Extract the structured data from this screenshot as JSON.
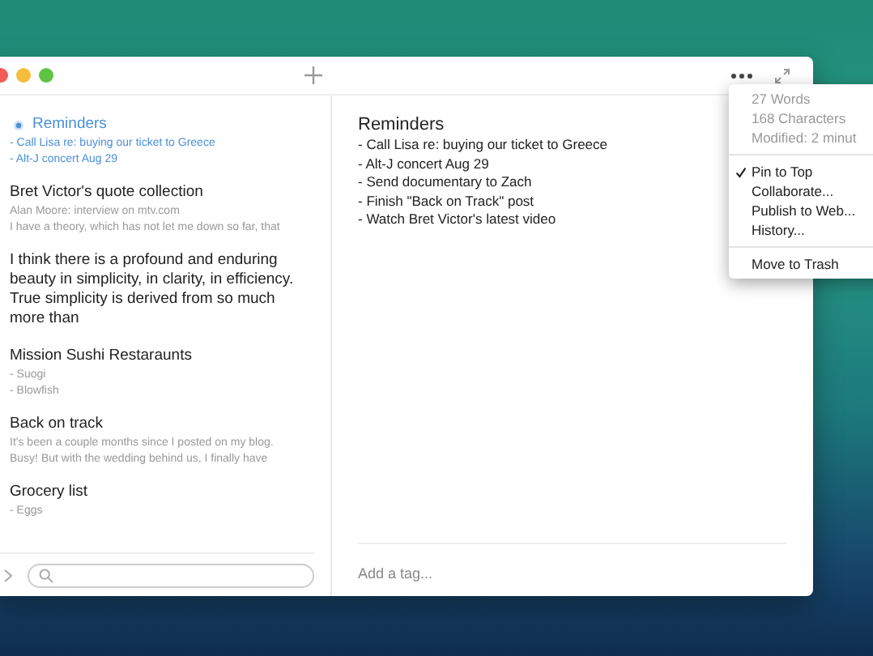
{
  "notes": [
    {
      "title": "Reminders",
      "lines": [
        "- Call Lisa re: buying our ticket to Greece",
        "- Alt-J concert Aug 29"
      ],
      "selected": true,
      "pinned": true
    },
    {
      "title": "Bret Victor's quote collection",
      "lines": [
        "Alan Moore: interview on mtv.com",
        "I have a theory, which has not let me down so far, that"
      ],
      "selected": false,
      "pinned": false
    },
    {
      "title": "I think there is a profound and enduring beauty in simplicity, in clarity, in efficiency. True simplicity is derived from so much more than",
      "selected": false,
      "pinned": false
    },
    {
      "title": "Mission Sushi Restaraunts",
      "lines": [
        "- Suogi",
        "- Blowfish"
      ],
      "selected": false,
      "pinned": false
    },
    {
      "title": "Back on track",
      "lines": [
        "It's been a couple months since I posted on my blog.",
        "Busy! But with the wedding behind us, I finally have"
      ],
      "selected": false,
      "pinned": false
    },
    {
      "title": "Grocery list",
      "lines": [
        "- Eggs"
      ],
      "selected": false,
      "pinned": false
    }
  ],
  "editor": {
    "title": "Reminders",
    "lines": [
      "- Call Lisa re: buying our ticket to Greece",
      "- Alt-J concert Aug 29",
      "- Send documentary to Zach",
      "- Finish \"Back on Track\" post",
      "- Watch Bret Victor's latest video"
    ],
    "tag_placeholder": "Add a tag..."
  },
  "menu": {
    "info": [
      "27 Words",
      "168 Characters",
      "Modified: 2 minut"
    ],
    "items": [
      {
        "label": "Pin to Top",
        "checked": true
      },
      {
        "label": "Collaborate...",
        "checked": false
      },
      {
        "label": "Publish to Web...",
        "checked": false
      },
      {
        "label": "History...",
        "checked": false
      }
    ],
    "danger": "Move to Trash"
  }
}
